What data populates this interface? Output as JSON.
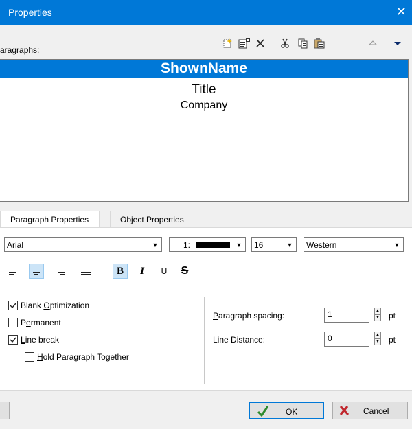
{
  "window": {
    "title": "Properties",
    "close_glyph": "✕"
  },
  "paragraphs": {
    "label": "aragraphs:",
    "items": [
      {
        "text": "ShownName",
        "selected": true
      },
      {
        "text": "Title",
        "selected": false
      },
      {
        "text": "Company",
        "selected": false
      }
    ]
  },
  "toolbar": {
    "icons": [
      "new-icon",
      "properties-icon",
      "delete-icon",
      "cut-icon",
      "copy-icon",
      "paste-icon",
      "move-up-icon",
      "move-down-icon"
    ]
  },
  "tabs": [
    {
      "label": "Paragraph Properties",
      "active": true
    },
    {
      "label": "Object Properties",
      "active": false
    }
  ],
  "format": {
    "font": "Arial",
    "color_prefix": "1:",
    "color_value": "#000000",
    "size": "16",
    "script": "Western",
    "bold": "B",
    "italic": "I",
    "underline": "U",
    "strike": "S",
    "alignment_selected": "center",
    "bold_on": true
  },
  "options": {
    "blank_optimization": {
      "label": "Blank Optimization",
      "checked": true
    },
    "permanent": {
      "label": "Permanent",
      "checked": false
    },
    "line_break": {
      "label": "Line break",
      "checked": true
    },
    "hold_together": {
      "label": "Hold Paragraph Together",
      "checked": false
    }
  },
  "spacing": {
    "paragraph_label": "Paragraph spacing:",
    "paragraph_value": "1",
    "line_label": "Line Distance:",
    "line_value": "0",
    "unit": "pt"
  },
  "buttons": {
    "ok": "OK",
    "cancel": "Cancel"
  },
  "colors": {
    "accent": "#0078d7",
    "ok_check": "#2e8b2e",
    "cancel_x": "#c0262d"
  }
}
